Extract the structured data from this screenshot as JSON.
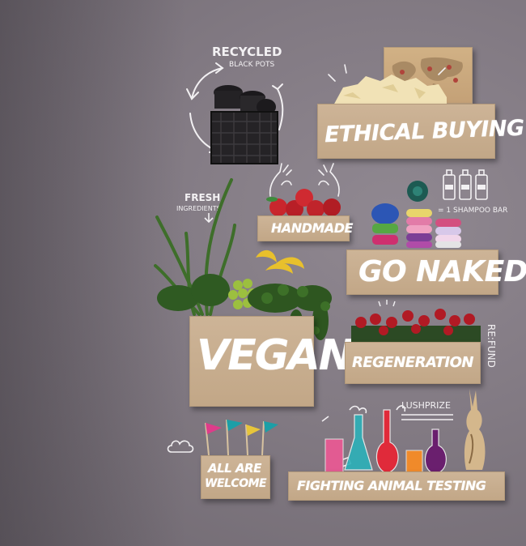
{
  "labels": {
    "ethical_buying": "Ethical Buying",
    "handmade": "Handmade",
    "go_naked": "Go Naked",
    "vegan": "Vegan",
    "regeneration": "Regeneration",
    "all_are_welcome_1": "All Are",
    "all_are_welcome_2": "Welcome",
    "fighting_animal_testing": "Fighting Animal Testing"
  },
  "annotations": {
    "recycled": "Recycled",
    "black_pots": "Black Pots",
    "fresh": "Fresh",
    "ingredients": "Ingredients",
    "shampoo_bar": "= 1 Shampoo Bar",
    "refund": "Re:Fund",
    "lushprize": "Lushprize"
  },
  "icons": {
    "recycle_arrows": "recycle-arrows-icon",
    "hands": "hands-icon",
    "bottles": "shampoo-bottles-icon",
    "clouds": "clouds-icon"
  }
}
